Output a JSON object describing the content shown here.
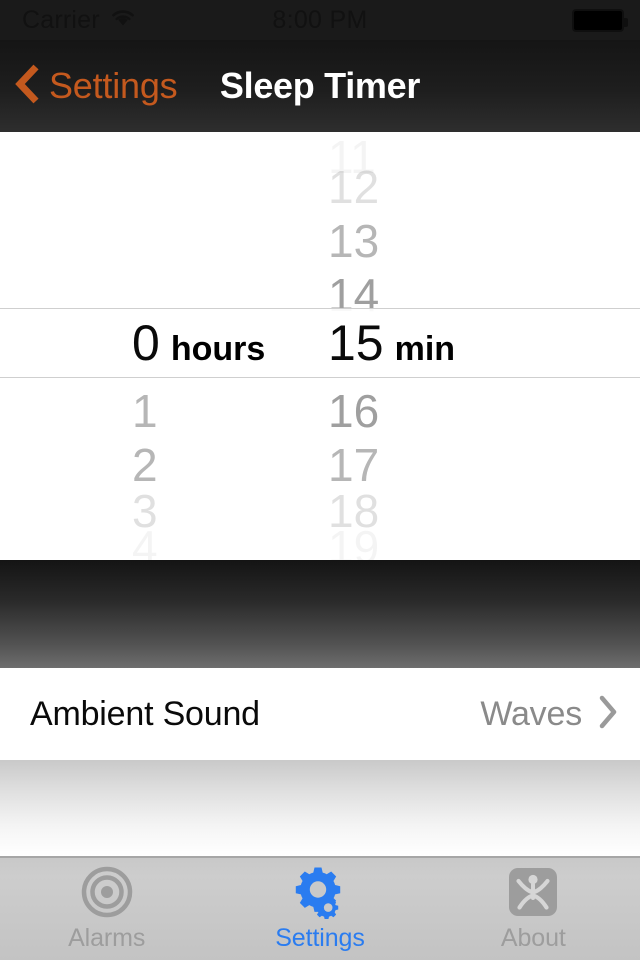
{
  "status_bar": {
    "carrier": "Carrier",
    "wifi_icon": "wifi-icon",
    "time": "8:00 PM",
    "battery_icon": "battery-full-icon"
  },
  "nav_bar": {
    "back_icon": "chevron-left-icon",
    "back_label": "Settings",
    "title": "Sleep Timer",
    "title_color": "#ffffff",
    "back_color": "#c4591e",
    "background_color": "#1e1e1e"
  },
  "picker": {
    "hours": {
      "unit_label": "hours",
      "selected": "0",
      "above": [
        "",
        "",
        ""
      ],
      "below": [
        "1",
        "2",
        "3",
        "4"
      ]
    },
    "minutes": {
      "unit_label": "min",
      "selected": "15",
      "above": [
        "11",
        "12",
        "13",
        "14"
      ],
      "below": [
        "16",
        "17",
        "18",
        "19"
      ]
    },
    "selection_border_color": "#cfcfcf"
  },
  "settings_row": {
    "label": "Ambient Sound",
    "value": "Waves",
    "disclosure_icon": "chevron-right-icon"
  },
  "tab_bar": {
    "active_color": "#2a7cf0",
    "inactive_color": "#9d9d9d",
    "tabs": [
      {
        "label": "Alarms",
        "icon": "target-bullseye-icon",
        "active": false
      },
      {
        "label": "Settings",
        "icon": "gears-icon",
        "active": true
      },
      {
        "label": "About",
        "icon": "person-badge-icon",
        "active": false
      }
    ]
  }
}
